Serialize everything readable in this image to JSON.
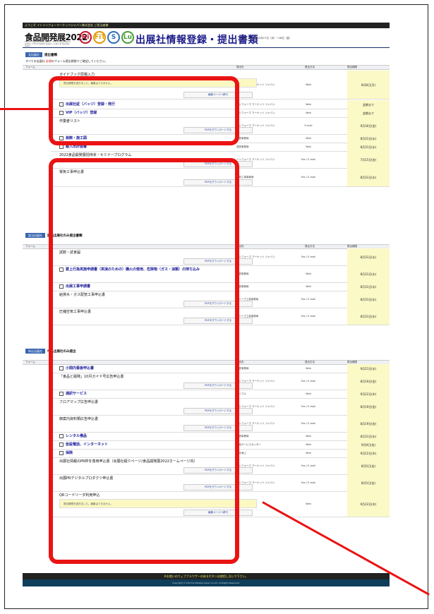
{
  "topbar": "ようこそ イトインフォーマーケッツジャパン株式会社 ご担当者様",
  "header": {
    "logo": "食品開発展2022",
    "logo_sub": "Health ingredients Japan / Food ingredients Japan / Food Safety Japan / Labo & Quality Japan",
    "circles": [
      {
        "label": "Hi",
        "color": "#c8102e"
      },
      {
        "label": "FiT",
        "color": "#e39a00"
      },
      {
        "label": "S",
        "color": "#2f6fb5"
      },
      {
        "label": "Lu",
        "color": "#4a9d3a"
      }
    ],
    "title": "出展社情報登録・提出書類",
    "date": "会期：2022年10月17日（月）〜18日（金）"
  },
  "sections": [
    {
      "tag": "全出展社",
      "title": "提出書類",
      "note_pre": "すべての出展社 ",
      "note_red": "必須",
      "note_post": "のフォーム提出期限でご確認してください。",
      "columns": [
        "フォーム",
        "提出先",
        "提出方法",
        "提出期限"
      ]
    },
    {
      "tag": "該当出展社",
      "title": "該当出展社のみ提出書類",
      "columns": [
        "フォーム",
        "提出先",
        "提出方法",
        "提出期限"
      ]
    },
    {
      "tag": "申込出展社",
      "title": "申込出展社のみ提出",
      "columns": [
        "フォーム",
        "提出先",
        "提出方法",
        "提出期限"
      ]
    }
  ],
  "rows": [
    {
      "name": "ガイドブック原稿入力",
      "link": false,
      "to": "インフォーマ マーケッツ ジャパン",
      "method": "Web",
      "due": "8月8日(月)",
      "info": "提出期限を過ぎました。編集はできません。",
      "btn": "編集ページへ移行"
    },
    {
      "name": "出展社証（バッジ）登録・発行",
      "link": true,
      "to": "インフォーマ マーケッツ ジャパン",
      "method": "Web",
      "due": "会期まで"
    },
    {
      "name": "VIP（バッジ）登録",
      "link": true,
      "to": "インフォーマ マーケッツ ジャパン",
      "method": "Web",
      "due": "会期まで"
    },
    {
      "name": "作業者リスト",
      "link": false,
      "to": "インフォーマ マーケッツ ジャパン",
      "method": "E-mail",
      "due": "9月30日(金)",
      "btn": "PDFをダウンロードする"
    },
    {
      "name": "装飾・施工図",
      "link": true,
      "to": "運営事務局",
      "method": "Web",
      "due": "8月31日(水)"
    },
    {
      "name": "搬入出計画書",
      "link": true,
      "to": "運営事務局",
      "method": "Web",
      "due": "8月31日(水)"
    },
    {
      "name": "2022食品開発展招待状・セミナープログラム",
      "link": false,
      "to": "インフォーマ マーケッツ ジャパン",
      "method": "Fax / E-mail",
      "due": "7月15日(金)",
      "btn": "PDFをダウンロードする"
    },
    {
      "name": "電気工事申込書",
      "link": false,
      "to": "電気工事事務局",
      "method": "Fax / E-mail",
      "due": "8月31日(水)",
      "btn": "PDFをダウンロードする"
    },
    {
      "name": "試飲・試食届",
      "link": false,
      "to": "インフォーマ マーケッツ ジャパン",
      "method": "Fax / E-mail",
      "due": "8月31日(水)",
      "btn": "PDFをダウンロードする"
    },
    {
      "name": "要上行為実施申請書（実演のための）機火の使用、危険物（ガス・油類）の持ち込み",
      "link": true,
      "to": "運営事務局",
      "method": "Web",
      "due": "8月31日(水)"
    },
    {
      "name": "出展工事申請書",
      "link": true,
      "to": "運営事務局",
      "method": "Web",
      "due": "8月31日(水)"
    },
    {
      "name": "給排水・ガス配管工事申込書",
      "link": false,
      "to": "オリーブ工事事務局",
      "method": "Fax / E-mail",
      "due": "8月31日(水)",
      "btn": "PDFをダウンロードする"
    },
    {
      "name": "圧縮空気工事申込書",
      "link": false,
      "to": "オリーブ工事事務局",
      "method": "Fax / E-mail",
      "due": "8月31日(水)",
      "btn": "PDFをダウンロードする"
    },
    {
      "name": "小間内看板申込書",
      "link": true,
      "to": "運営事務局",
      "method": "Web",
      "due": "9月21日(水)"
    },
    {
      "name": "「食品と開発」10月ガイド号広告申込書",
      "link": false,
      "to": "インフォーマ マーケッツ ジャパン",
      "method": "Fax / E-mail",
      "due": "8月19日(金)",
      "btn": "PDFをダウンロードする"
    },
    {
      "name": "通訳サービス",
      "link": true,
      "to": "サイマル",
      "method": "Web",
      "due": "9月22日(木)"
    },
    {
      "name": "フロアマップ広告申込書",
      "link": false,
      "to": "インフォーマ マーケッツ ジャパン",
      "method": "Fax / E-mail",
      "due": "8月19日(金)",
      "btn": "PDFをダウンロードする"
    },
    {
      "name": "御案内資料類広告申込書",
      "link": false,
      "to": "インフォーマ マーケッツ ジャパン",
      "method": "Fax / E-mail",
      "due": "8月19日(金)",
      "btn": "PDFをダウンロードする"
    },
    {
      "name": "レンタル備品",
      "link": true,
      "to": "運営事務局",
      "method": "Web",
      "due": "8月31日(水)"
    },
    {
      "name": "仮設電話、インターネット",
      "link": true,
      "to": "電話サービスセンター",
      "method": "Web",
      "due": "9月9日(金)"
    },
    {
      "name": "保険",
      "link": true,
      "to": "東京海上",
      "method": "Web",
      "due": "9月22日(木)"
    },
    {
      "name": "出展社情報のPR枠を専用申込書（出展社紹介ページ/食品開発展2022ホームページ内）",
      "link": false,
      "to": "インフォーマ マーケッツ ジャパン",
      "method": "Fax / E-mail",
      "due": "8月5日(金)",
      "btn": "PDFをダウンロードする"
    },
    {
      "name": "出展PRデジタルプロダクツ申込書",
      "link": false,
      "to": "インフォーマ マーケッツ ジャパン",
      "method": "Fax / E-mail",
      "due": "8月5日(金)",
      "btn": "PDFをダウンロードする"
    },
    {
      "name": "QRコードリーダ利用申込",
      "link": false,
      "to": "ダイセン",
      "method": "Web",
      "due": "9月22日(木)",
      "info": "提出期限を過ぎました。編集はできません。",
      "btn": "編集ページへ移行"
    }
  ],
  "footer": {
    "warning": "※お使いのウェブブラウザーの戻るボタンは使用しないで下さい。",
    "copyright": "Copyright © Informa Markets Japan Co.Ltd. All Rights Reserved."
  },
  "annotation_color": "#ea1313"
}
